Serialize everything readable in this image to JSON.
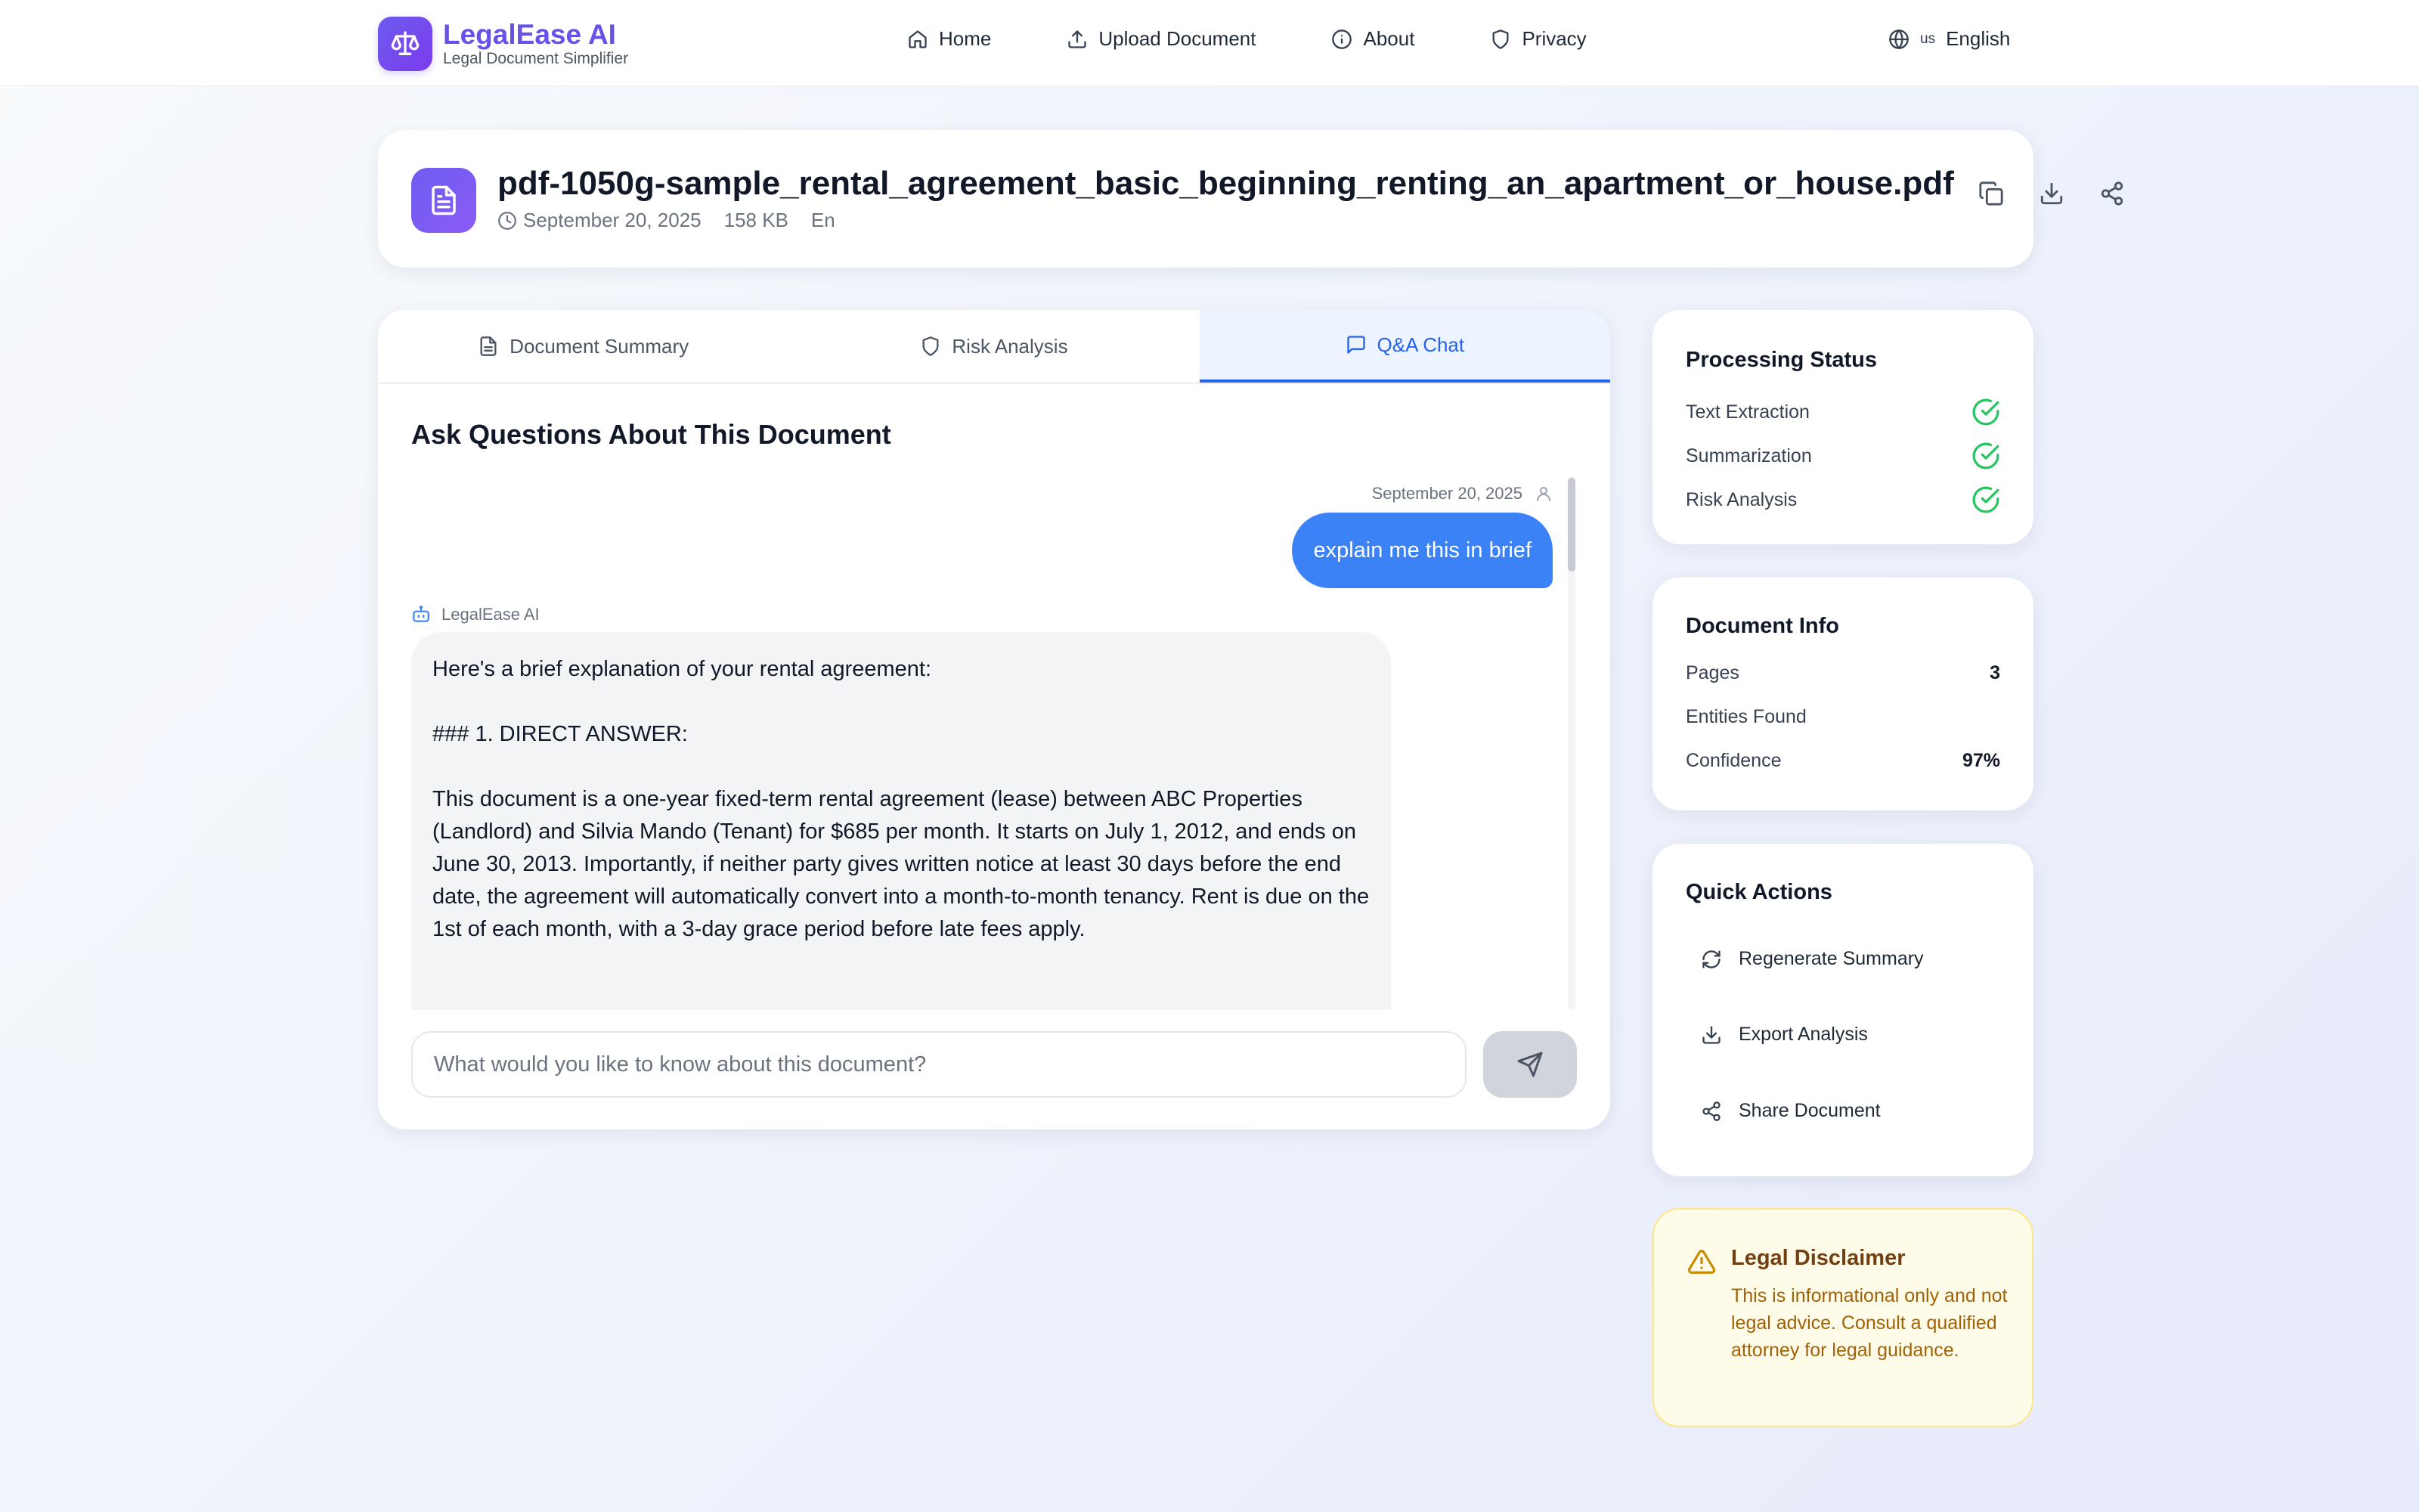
{
  "app": {
    "name": "LegalEase AI",
    "subtitle": "Legal Document Simplifier"
  },
  "nav": {
    "items": [
      {
        "label": "Home",
        "icon": "home-icon"
      },
      {
        "label": "Upload Document",
        "icon": "upload-icon"
      },
      {
        "label": "About",
        "icon": "info-icon"
      },
      {
        "label": "Privacy",
        "icon": "shield-icon"
      }
    ],
    "language": {
      "flag": "us",
      "label": "English",
      "icon": "globe-icon"
    }
  },
  "document": {
    "file_name": "pdf-1050g-sample_rental_agreement_basic_beginning_renting_an_apartment_or_house.pdf",
    "date": "September 20, 2025",
    "size": "158 KB",
    "language": "En",
    "actions": [
      "copy-icon",
      "download-icon",
      "share-icon"
    ]
  },
  "tabs": [
    {
      "label": "Document Summary",
      "icon": "document-icon",
      "active": false
    },
    {
      "label": "Risk Analysis",
      "icon": "shield-icon",
      "active": false
    },
    {
      "label": "Q&A Chat",
      "icon": "chat-icon",
      "active": true
    }
  ],
  "chat": {
    "title": "Ask Questions About This Document",
    "user_message": {
      "timestamp": "September 20, 2025",
      "text": "explain me this in brief"
    },
    "ai_message": {
      "sender": "LegalEase AI",
      "paragraphs": [
        "Here's a brief explanation of your rental agreement:",
        "### 1. DIRECT ANSWER:",
        "This document is a one-year fixed-term rental agreement (lease) between ABC Properties (Landlord) and Silvia Mando (Tenant) for $685 per month. It starts on July 1, 2012, and ends on June 30, 2013. Importantly, if neither party gives written notice at least 30 days before the end date, the agreement will automatically convert into a month-to-month tenancy. Rent is due on the 1st of each month, with a 3-day grace period before late fees apply."
      ]
    },
    "input_placeholder": "What would you like to know about this document?",
    "input_value": ""
  },
  "processing_status": {
    "title": "Processing Status",
    "items": [
      {
        "label": "Text Extraction",
        "done": true
      },
      {
        "label": "Summarization",
        "done": true
      },
      {
        "label": "Risk Analysis",
        "done": true
      }
    ]
  },
  "document_info": {
    "title": "Document Info",
    "rows": [
      {
        "label": "Pages",
        "value": "3"
      },
      {
        "label": "Entities Found",
        "value": ""
      },
      {
        "label": "Confidence",
        "value": "97%"
      }
    ]
  },
  "quick_actions": {
    "title": "Quick Actions",
    "items": [
      {
        "label": "Regenerate Summary",
        "icon": "refresh-icon"
      },
      {
        "label": "Export Analysis",
        "icon": "download-icon"
      },
      {
        "label": "Share Document",
        "icon": "share-icon"
      }
    ]
  },
  "disclaimer": {
    "title": "Legal Disclaimer",
    "text": "This is informational only and not legal advice. Consult a qualified attorney for legal guidance."
  },
  "colors": {
    "brand": "#6652e6",
    "accent": "#3b82f6",
    "success": "#22c55e",
    "warning": "#ca8a04"
  }
}
